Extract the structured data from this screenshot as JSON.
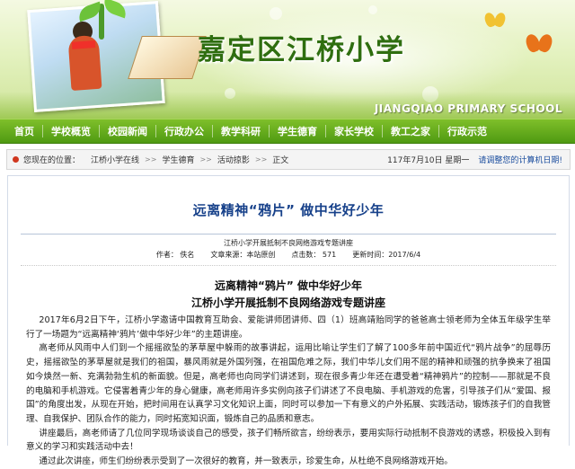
{
  "header": {
    "school_name": "嘉定区江桥小学",
    "school_name_en": "JIANGQIAO PRIMARY SCHOOL"
  },
  "nav": {
    "items": [
      "首页",
      "学校概览",
      "校园新闻",
      "行政办公",
      "教学科研",
      "学生德育",
      "家长学校",
      "教工之家",
      "行政示范"
    ]
  },
  "breadcrumb": {
    "label": "您现在的位置：",
    "items": [
      "江桥小学在线",
      "学生德育",
      "活动掠影",
      "正文"
    ],
    "date": "117年7月10日 星期一",
    "ie_link": "请调整您的计算机日期!"
  },
  "article": {
    "title": "远离精神“鸦片”   做中华好少年",
    "subject": "江桥小学开展抵制不良网络游戏专题讲座",
    "meta": {
      "author": "作者：  佚名",
      "source": "文章来源：本站原创",
      "clicks": "点击数：  571",
      "updated": "更新时间：2017/6/4"
    },
    "heading1": "远离精神“鸦片”   做中华好少年",
    "heading2": "江桥小学开展抵制不良网络游戏专题讲座",
    "paragraphs": [
      "2017年6月2日下午，江桥小学邀请中国教育互助会、爱能讲师团讲师、四（1）班高靖贻同学的爸爸高士领老师为全体五年级学生举行了一场题为“远离精神‘鸦片’做中华好少年”的主题讲座。",
      "高老师从风雨中人们到一个摇摇欲坠的茅草屋中躲雨的故事讲起，运用比喻让学生们了解了100多年前中国近代“鸦片战争”的屈辱历史，摇摇欲坠的茅草屋就是我们的祖国，暴风雨就是外国列强，在祖国危难之际，我们中华儿女们用不屈的精神和顽强的抗争换来了祖国如今焕然一新、充满勃勃生机的新面貌。但是，高老师也向同学们讲述到，现在很多青少年还在遭受着“精神鸦片”的控制——那就是不良的电脑和手机游戏。它侵害着青少年的身心健康，高老师用许多实例向孩子们讲述了不良电脑、手机游戏的危害，引导孩子们从“爱国、报国”的角度出发，从现在开始，把时间用在认真学习文化知识上面，同时可以参加一下有意义的户外拓展、实践活动，锻炼孩子们的自我管理、自我保护、团队合作的能力，同时拓宽知识面，锻炼自己的品质和意志。",
      "讲座最后，高老师请了几位同学现场谈谈自己的感受，孩子们畅所欲言，纷纷表示，要用实际行动抵制不良游戏的诱惑，积极投入到有意义的学习和实践活动中去！",
      "通过此次讲座，师生们纷纷表示受到了一次很好的教育，并一致表示，珍爱生命，从杜绝不良网络游戏开始。"
    ]
  }
}
